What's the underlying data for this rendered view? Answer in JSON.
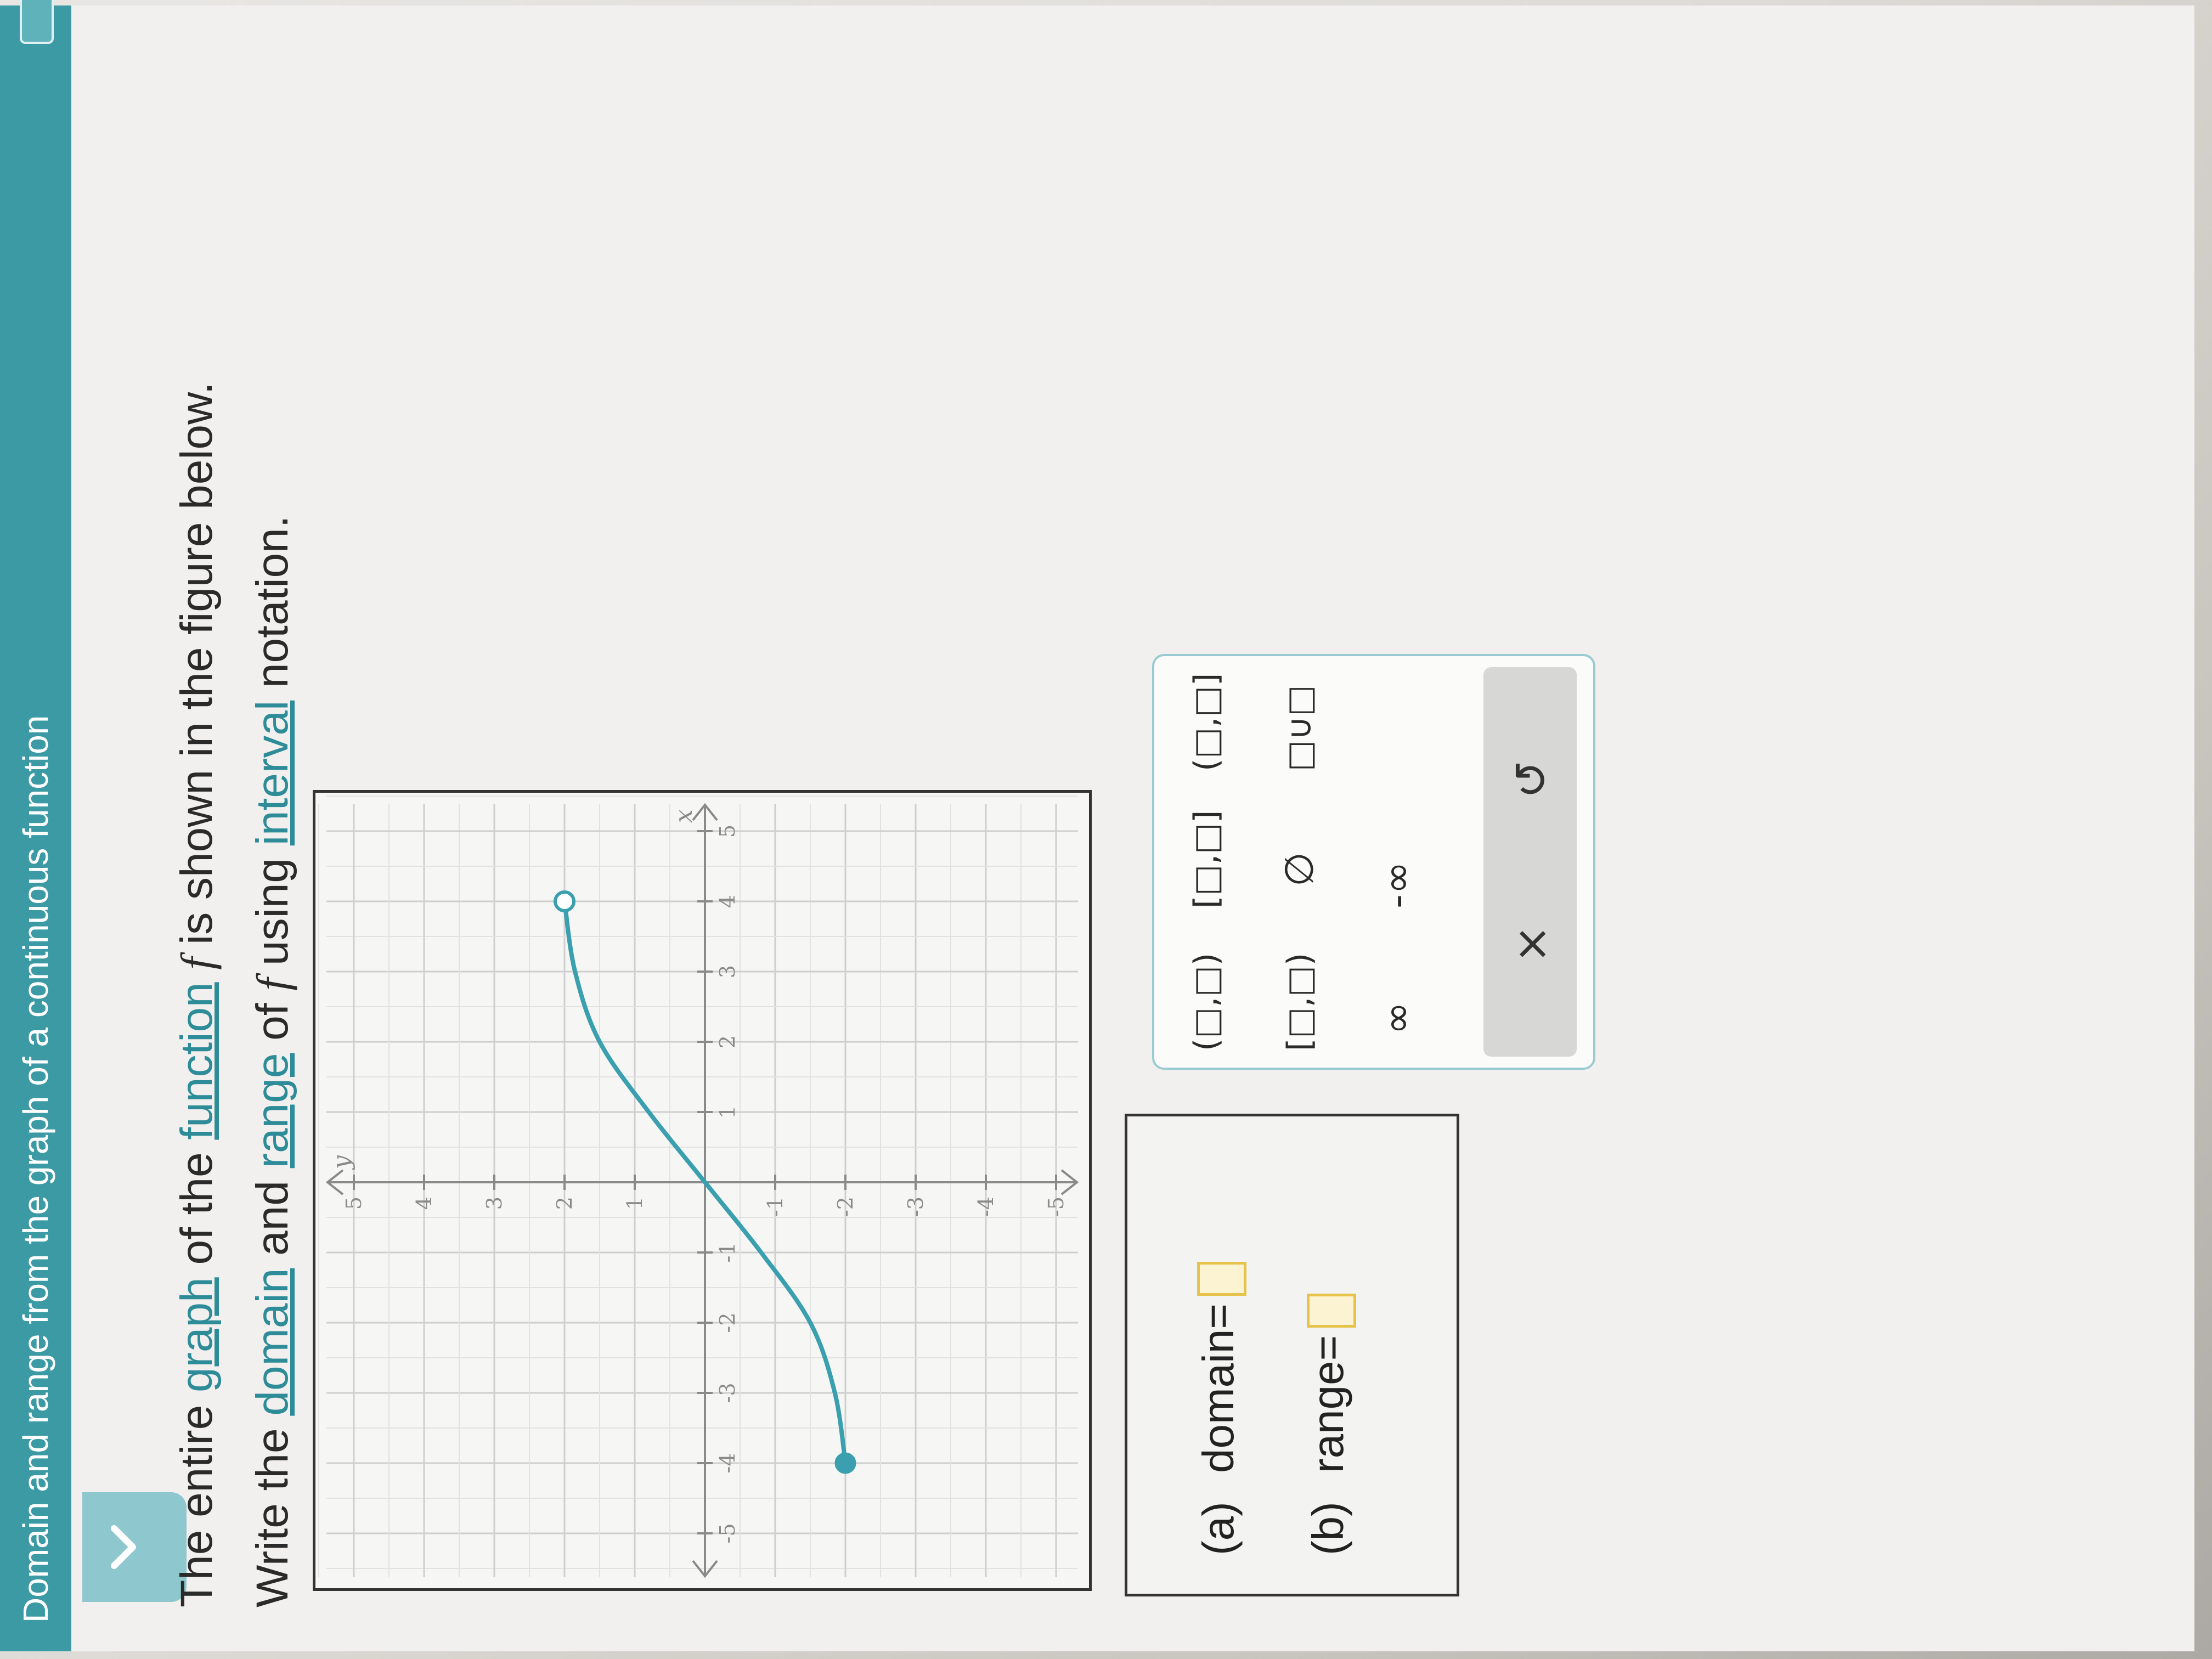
{
  "header": {
    "title": "Domain and range from the graph of a continuous function"
  },
  "question": {
    "line1_pre": "The entire ",
    "link_graph": "graph",
    "line1_mid": " of the ",
    "link_function": "function",
    "fvar": "f",
    "line1_post": " is shown in the figure below.",
    "line2_pre": "Write the ",
    "link_domain": "domain",
    "line2_and": " and ",
    "link_range": "range",
    "line2_of": " of ",
    "line2_using": " using ",
    "link_interval": "interval",
    "line2_post": " notation."
  },
  "chart_data": {
    "type": "line",
    "xlabel": "x",
    "ylabel": "y",
    "xlim": [
      -5,
      5
    ],
    "ylim": [
      -5,
      5
    ],
    "x_ticks": [
      -5,
      -4,
      -3,
      -2,
      -1,
      1,
      2,
      3,
      4,
      5
    ],
    "y_ticks": [
      -5,
      -4,
      -3,
      -2,
      -1,
      1,
      2,
      3,
      4,
      5
    ],
    "grid": true,
    "series": [
      {
        "points": [
          [
            -4,
            -2
          ],
          [
            -3,
            -1.85
          ],
          [
            -2,
            -1.5
          ],
          [
            -1,
            -0.8
          ],
          [
            0,
            0
          ],
          [
            1,
            0.8
          ],
          [
            2,
            1.5
          ],
          [
            3,
            1.85
          ],
          [
            4,
            2
          ]
        ],
        "start": {
          "x": -4,
          "y": -2,
          "closed": true
        },
        "end": {
          "x": 4,
          "y": 2,
          "closed": false
        }
      }
    ]
  },
  "answers": {
    "a_label": "(a)",
    "a_text": "domain=",
    "b_label": "(b)",
    "b_text": "range="
  },
  "palette": {
    "open_open": "(□,□)",
    "closed_closed": "[□,□]",
    "open_closed": "(□,□]",
    "closed_open": "[□,□)",
    "empty_set": "∅",
    "union": "□∪□",
    "infinity": "∞",
    "neg_infinity": "-∞",
    "clear": "×",
    "undo": "↺"
  },
  "colors": {
    "header": "#3c9aa5",
    "curve": "#3a9fae",
    "slot_border": "#e6c44c"
  }
}
